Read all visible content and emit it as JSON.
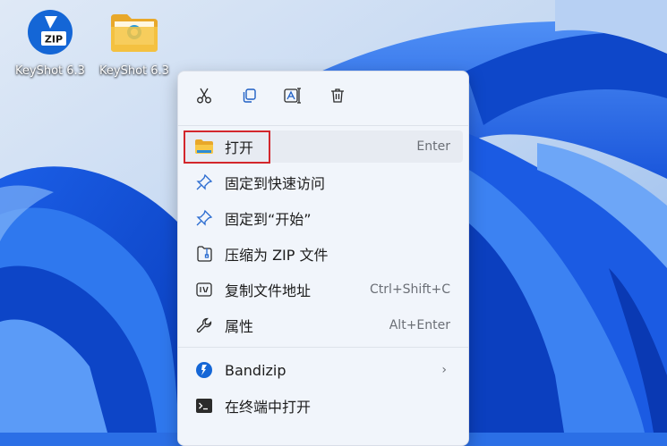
{
  "desktop": {
    "icons": [
      {
        "label": "KeyShot 6.3",
        "icon": "bandizip-zip-icon"
      },
      {
        "label": "KeyShot 6.3",
        "icon": "folder-icon"
      }
    ]
  },
  "context_menu": {
    "toolbar": [
      {
        "icon": "cut-icon"
      },
      {
        "icon": "copy-icon"
      },
      {
        "icon": "rename-icon"
      },
      {
        "icon": "delete-icon"
      }
    ],
    "items": [
      {
        "label": "打开",
        "shortcut": "Enter",
        "icon": "folder-open-icon"
      },
      {
        "label": "固定到快速访问",
        "shortcut": "",
        "icon": "pin-icon"
      },
      {
        "label": "固定到“开始”",
        "shortcut": "",
        "icon": "pin-icon"
      },
      {
        "label": "压缩为 ZIP 文件",
        "shortcut": "",
        "icon": "zip-icon"
      },
      {
        "label": "复制文件地址",
        "shortcut": "Ctrl+Shift+C",
        "icon": "copy-path-icon"
      },
      {
        "label": "属性",
        "shortcut": "Alt+Enter",
        "icon": "wrench-icon"
      },
      {
        "label": "Bandizip",
        "shortcut": "",
        "icon": "bandizip-icon",
        "submenu": true
      },
      {
        "label": "在终端中打开",
        "shortcut": "",
        "icon": "terminal-icon"
      }
    ]
  },
  "colors": {
    "highlight_border": "#d3272c",
    "menu_background": "#f1f5fb",
    "wallpaper_blue": "#2b6fe6"
  }
}
